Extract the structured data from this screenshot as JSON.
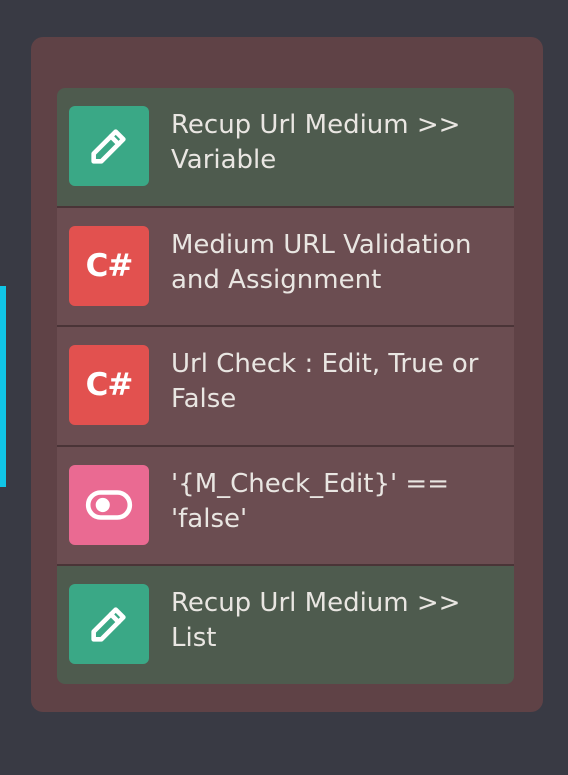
{
  "workflow": {
    "steps": [
      {
        "label": "Recup Url Medium >> Variable",
        "icon": "pencil-icon",
        "icon_color": "#3aa886",
        "row_color": "#4e5b4e"
      },
      {
        "label": "Medium URL Validation and Assignment",
        "icon_text": "C#",
        "icon_color": "#e2514f",
        "row_color": "#6b4d51"
      },
      {
        "label": "Url Check : Edit, True or False",
        "icon_text": "C#",
        "icon_color": "#e2514f",
        "row_color": "#6b4d51"
      },
      {
        "label": "'{M_Check_Edit}' == 'false'",
        "icon": "toggle-icon",
        "icon_color": "#ea6a92",
        "row_color": "#6b4d51"
      },
      {
        "label": "Recup Url Medium >> List",
        "icon": "pencil-icon",
        "icon_color": "#3aa886",
        "row_color": "#4e5b4e"
      }
    ]
  },
  "colors": {
    "canvas": "#393a44",
    "group": "#5f4246",
    "connector": "#10c5e6"
  }
}
